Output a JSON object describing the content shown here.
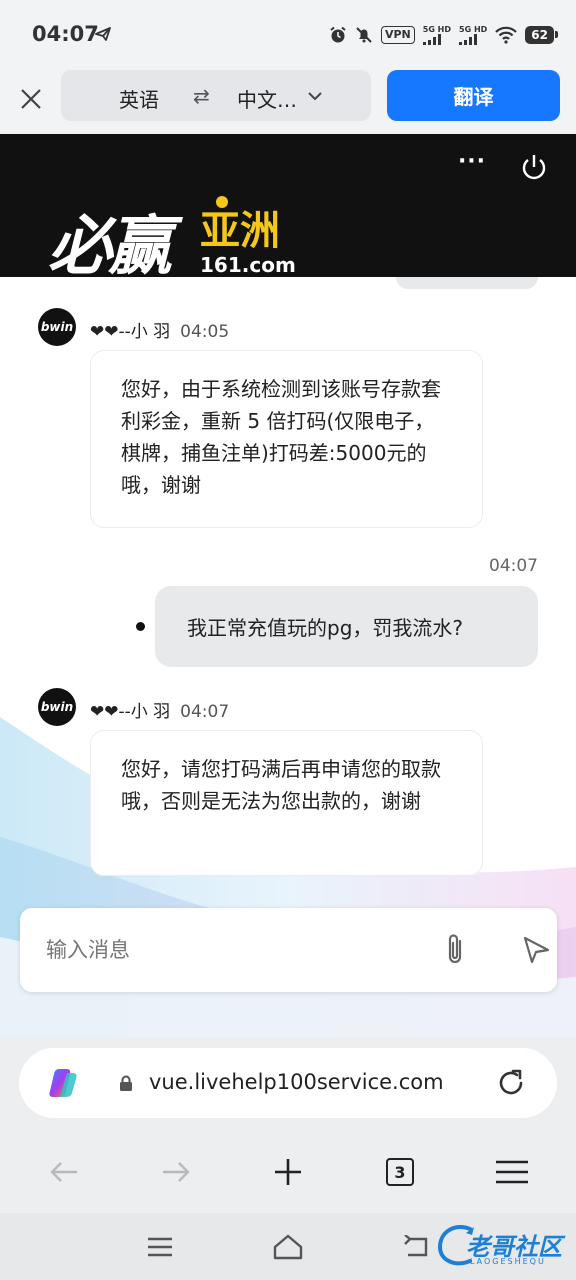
{
  "status_bar": {
    "time": "04:07",
    "vpn": "VPN",
    "signal1": "5G HD",
    "signal2": "5G HD",
    "battery": "62"
  },
  "translate_bar": {
    "source_lang": "英语",
    "swap": "⇄",
    "target_lang": "中文…",
    "translate_label": "翻译"
  },
  "banner": {
    "more": "···",
    "logo_main": "必赢",
    "logo_asia": "亚洲",
    "logo_url": "161.com"
  },
  "chat": {
    "messages": [
      {
        "avatar": "bwin",
        "sender": "❤❤--小 羽",
        "time": "04:05",
        "text": "您好，由于系统检测到该账号存款套利彩金，重新 5 倍打码(仅限电子，棋牌，捕鱼注单)打码差:5000元的哦，谢谢"
      },
      {
        "time": "04:07",
        "text": "我正常充值玩的pg，罚我流水?"
      },
      {
        "avatar": "bwin",
        "sender": "❤❤--小 羽",
        "time": "04:07",
        "text": "您好，请您打码满后再申请您的取款哦，否则是无法为您出款的，谢谢"
      }
    ],
    "input_placeholder": "输入消息"
  },
  "browser": {
    "url": "vue.livehelp100service.com",
    "tabs_count": "3"
  },
  "watermark": {
    "text": "老哥社区",
    "sub": "LAOGESHEQU"
  },
  "colors": {
    "accent": "#1677ff",
    "logo_yellow": "#f5c71a"
  }
}
